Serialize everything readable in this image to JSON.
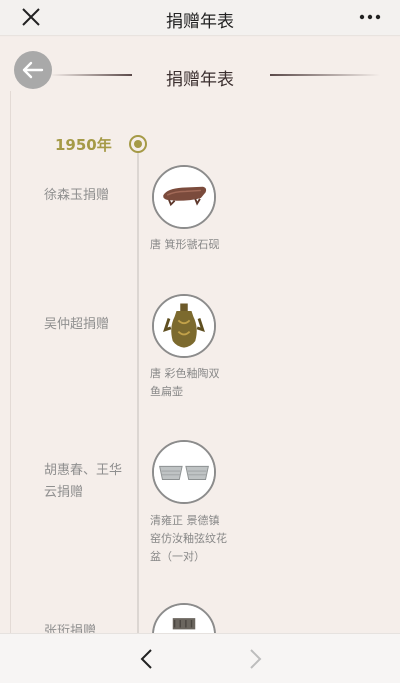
{
  "topbar": {
    "title": "捐赠年表",
    "close_icon": "close-icon",
    "more_icon": "more-icon"
  },
  "section": {
    "title": "捐赠年表",
    "back_icon": "arrow-left-icon"
  },
  "timeline": {
    "year": "1950年",
    "accent": "#a59a47"
  },
  "entries": [
    {
      "donor": "徐森玉捐赠",
      "caption": "唐 箕形虢石砚"
    },
    {
      "donor": "吴仲超捐赠",
      "caption": "唐 彩色釉陶双鱼扁壶"
    },
    {
      "donor": "胡惠春、王华云捐赠",
      "caption": "清雍正 景德镇窑仿汝釉弦纹花盆（一对）"
    },
    {
      "donor": "张珩捐赠",
      "caption": ""
    }
  ],
  "bottombar": {
    "back_icon": "chevron-left-icon",
    "forward_icon": "chevron-right-icon"
  }
}
